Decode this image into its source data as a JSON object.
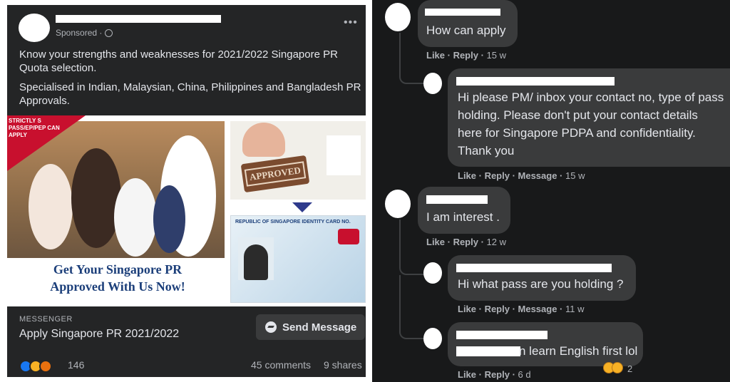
{
  "post": {
    "sponsored": "Sponsored ·",
    "menu": "•••",
    "text1": "Know your strengths and weaknesses for 2021/2022 Singapore PR Quota selection.",
    "text2": "Specialised in Indian, Malaysian, China, Philippines and Bangladesh PR Approvals.",
    "ad": {
      "banner": "STRICTLY S PASS/EP/PEP CAN APPLY",
      "stamp": "APPROVED",
      "card_heading": "REPUBLIC OF SINGAPORE IDENTITY CARD NO.",
      "headline_line1": "Get Your Singapore PR",
      "headline_line2": "Approved With Us Now!"
    },
    "messenger_label": "MESSENGER",
    "messenger_title": "Apply Singapore PR 2021/2022",
    "send_button": "Send Message",
    "reaction_count": "146",
    "comments": "45 comments",
    "shares": "9 shares"
  },
  "comments": [
    {
      "text": "How can apply",
      "actions": "Like · Reply ·",
      "time": "15 w"
    },
    {
      "text_lines": [
        "Hi please PM/ inbox your contact no, type of pass",
        "holding. Please don't put your contact details",
        "here for Singapore PDPA and confidentiality.",
        "Thank you"
      ],
      "actions": "Like · Reply · Message ·",
      "time": "15 w"
    },
    {
      "text": "I am interest .",
      "actions": "Like · Reply ·",
      "time": "12 w"
    },
    {
      "text": "Hi what pass are you holding ?",
      "actions": "Like · Reply · Message ·",
      "time": "11 w"
    },
    {
      "text": "n learn English first lol",
      "actions": "Like · Reply ·",
      "time": "6 d",
      "reaction_count": "2"
    }
  ],
  "colors": {
    "facebook_blue": "#1877f2",
    "card_bg": "#242526",
    "bubble_bg": "#3a3b3c",
    "text_primary": "#e4e6eb",
    "text_secondary": "#b0b3b8"
  }
}
